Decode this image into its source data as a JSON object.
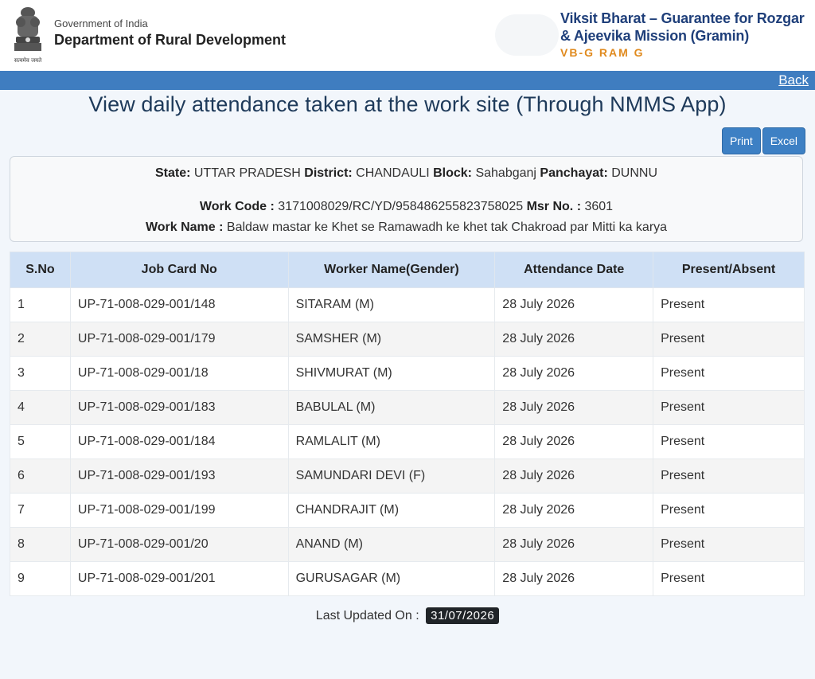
{
  "header": {
    "gov_small": "Government of India",
    "gov_big": "Department of Rural Development",
    "emblem_caption": "सत्यमेव जयते",
    "emblem_icon": "ashoka-emblem-icon",
    "mission_line1": "Viksit Bharat – Guarantee for Rozgar",
    "mission_line2": "& Ajeevika Mission (Gramin)",
    "mission_short": "VB-G RAM G"
  },
  "nav": {
    "back_label": "Back"
  },
  "page": {
    "title": "View daily attendance taken at the work site (Through NMMS App)"
  },
  "toolbar": {
    "print_label": "Print",
    "excel_label": "Excel"
  },
  "info": {
    "state_label": "State:",
    "state": "UTTAR PRADESH",
    "district_label": "District:",
    "district": "CHANDAULI",
    "block_label": "Block:",
    "block": "Sahabganj",
    "panchayat_label": "Panchayat:",
    "panchayat": "DUNNU",
    "work_code_label": "Work Code :",
    "work_code": "3171008029/RC/YD/958486255823758025",
    "msr_label": "Msr No. :",
    "msr": "3601",
    "work_name_label": "Work Name :",
    "work_name": "Baldaw mastar ke Khet se Ramawadh ke khet tak Chakroad par Mitti ka karya"
  },
  "table": {
    "headers": [
      "S.No",
      "Job Card No",
      "Worker Name(Gender)",
      "Attendance Date",
      "Present/Absent"
    ],
    "rows": [
      [
        "1",
        "UP-71-008-029-001/148",
        "SITARAM (M)",
        "28 July 2026",
        "Present"
      ],
      [
        "2",
        "UP-71-008-029-001/179",
        "SAMSHER (M)",
        "28 July 2026",
        "Present"
      ],
      [
        "3",
        "UP-71-008-029-001/18",
        "SHIVMURAT (M)",
        "28 July 2026",
        "Present"
      ],
      [
        "4",
        "UP-71-008-029-001/183",
        "BABULAL (M)",
        "28 July 2026",
        "Present"
      ],
      [
        "5",
        "UP-71-008-029-001/184",
        "RAMLALIT (M)",
        "28 July 2026",
        "Present"
      ],
      [
        "6",
        "UP-71-008-029-001/193",
        "SAMUNDARI DEVI (F)",
        "28 July 2026",
        "Present"
      ],
      [
        "7",
        "UP-71-008-029-001/199",
        "CHANDRAJIT (M)",
        "28 July 2026",
        "Present"
      ],
      [
        "8",
        "UP-71-008-029-001/20",
        "ANAND (M)",
        "28 July 2026",
        "Present"
      ],
      [
        "9",
        "UP-71-008-029-001/201",
        "GURUSAGAR (M)",
        "28 July 2026",
        "Present"
      ]
    ]
  },
  "footer": {
    "updated_label": "Last Updated On :",
    "updated_date": "31/07/2026"
  },
  "colors": {
    "bar_blue": "#3f7dc0",
    "header_row": "#cfe0f5",
    "mission_blue": "#1f3f7a",
    "mission_orange": "#e08a1e"
  }
}
